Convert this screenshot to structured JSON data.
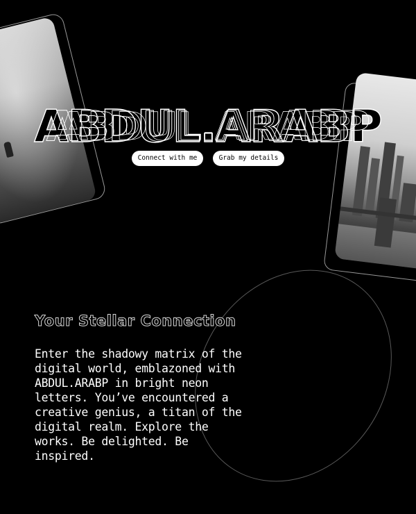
{
  "hero": {
    "title": "ABDUL.ARABP"
  },
  "buttons": {
    "connect_label": "Connect with me",
    "grab_label": "Grab my details"
  },
  "section": {
    "title": "Your Stellar Connection",
    "body": "Enter the shadowy matrix of the digital world, emblazoned with ABDUL.ARABP in bright neon letters. You’ve encountered a creative genius, a titan of the digital realm. Explore the works. Be delighted. Be inspired."
  },
  "images": {
    "left_card": "foggy-figure-photo",
    "right_card": "city-skyline-bridge-photo"
  },
  "colors": {
    "background": "#000000",
    "foreground": "#ffffff",
    "button_bg": "#ffffff",
    "button_text": "#000000"
  }
}
